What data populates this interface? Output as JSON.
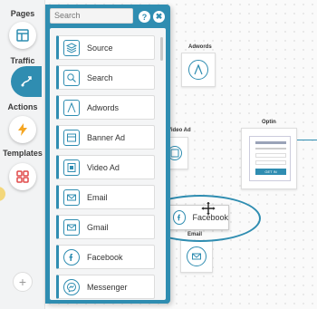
{
  "rail": {
    "pages_label": "Pages",
    "traffic_label": "Traffic",
    "actions_label": "Actions",
    "templates_label": "Templates",
    "add_symbol": "+"
  },
  "panel": {
    "search_placeholder": "Search",
    "help_symbol": "?",
    "close_symbol": "✖",
    "items": [
      {
        "label": "Source",
        "icon": "layers-icon"
      },
      {
        "label": "Search",
        "icon": "search-icon"
      },
      {
        "label": "Adwords",
        "icon": "adwords-icon"
      },
      {
        "label": "Banner Ad",
        "icon": "banner-icon"
      },
      {
        "label": "Video Ad",
        "icon": "video-icon"
      },
      {
        "label": "Email",
        "icon": "envelope-icon"
      },
      {
        "label": "Gmail",
        "icon": "gmail-icon"
      },
      {
        "label": "Facebook",
        "icon": "facebook-icon"
      },
      {
        "label": "Messenger",
        "icon": "messenger-icon"
      }
    ]
  },
  "canvas": {
    "adwords_label": "Adwords",
    "video_label": "Video Ad",
    "optin_label": "Optin",
    "optin_button": "GET IN",
    "email_label": "Email",
    "drag_label": "Facebook"
  },
  "colors": {
    "accent": "#2f8db1",
    "actions": "#f5a623",
    "templates": "#e04848"
  }
}
